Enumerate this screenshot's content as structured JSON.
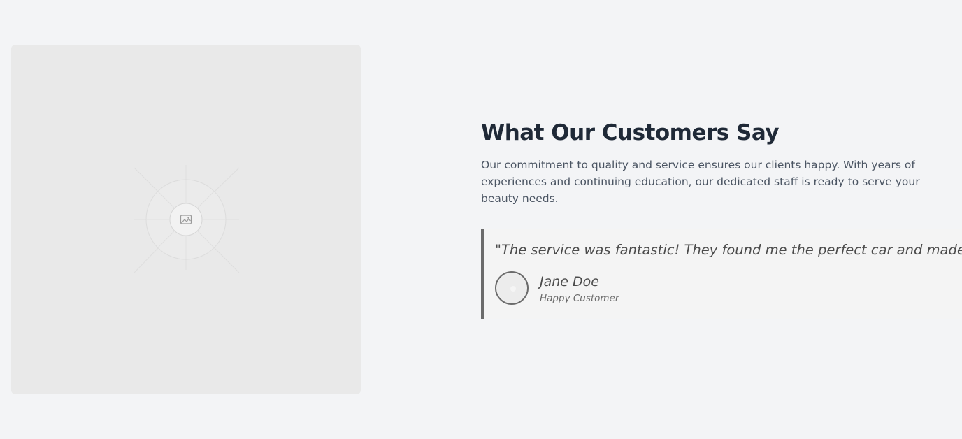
{
  "hero_image": {
    "icon": "image-placeholder-icon"
  },
  "section": {
    "heading": "What Our Customers Say",
    "description": "Our commitment to quality and service ensures our clients happy. With years of experiences and continuing education, our dedicated staff is ready to serve your beauty needs."
  },
  "testimonial": {
    "quote": "\"The service was fantastic! They found me the perfect car and made",
    "author_name": "Jane Doe",
    "author_role": "Happy Customer",
    "avatar_icon": "avatar-placeholder-icon"
  },
  "colors": {
    "background": "#f3f4f6",
    "heading": "#1f2937",
    "body_text": "#4b5563",
    "accent_border": "#6b6b6b"
  }
}
